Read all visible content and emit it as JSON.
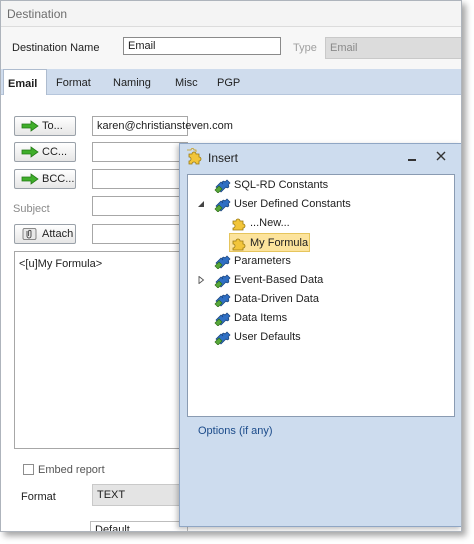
{
  "window": {
    "title": "Destination"
  },
  "destination": {
    "name_label": "Destination Name",
    "name_value": "Email",
    "type_label": "Type",
    "type_value": "Email"
  },
  "tabs": [
    {
      "label": "Email",
      "active": true
    },
    {
      "label": "Format"
    },
    {
      "label": "Naming"
    },
    {
      "label": "Misc"
    },
    {
      "label": "PGP"
    }
  ],
  "email": {
    "to_label": "To...",
    "to_value": "karen@christiansteven.com",
    "cc_label": "CC...",
    "bcc_label": "BCC...",
    "subject_label": "Subject",
    "attach_label": "Attach",
    "body_text": "<[u]My Formula>",
    "embed_label": "Embed report",
    "format_label": "Format",
    "format_value": "TEXT",
    "default_value": "Default"
  },
  "insert_panel": {
    "title": "Insert",
    "options_link": "Options (if any)",
    "tree": [
      {
        "label": "SQL-RD Constants",
        "icon": "puzzle-icon"
      },
      {
        "label": "User Defined Constants",
        "icon": "puzzle-icon",
        "expanded": true
      },
      {
        "label": "...New...",
        "icon": "yellow-puzzle-icon"
      },
      {
        "label": "My Formula",
        "icon": "yellow-puzzle-icon",
        "selected": true
      },
      {
        "label": "Parameters",
        "icon": "puzzle-icon"
      },
      {
        "label": "Event-Based Data",
        "icon": "puzzle-icon",
        "collapsed": true
      },
      {
        "label": "Data-Driven Data",
        "icon": "puzzle-icon"
      },
      {
        "label": "Data Items",
        "icon": "puzzle-icon"
      },
      {
        "label": "User Defaults",
        "icon": "puzzle-icon"
      }
    ]
  },
  "colors": {
    "tab_bar": "#cfdced",
    "panel": "#cddcee",
    "selection": "#fce39c",
    "link": "#1b4b8a"
  }
}
